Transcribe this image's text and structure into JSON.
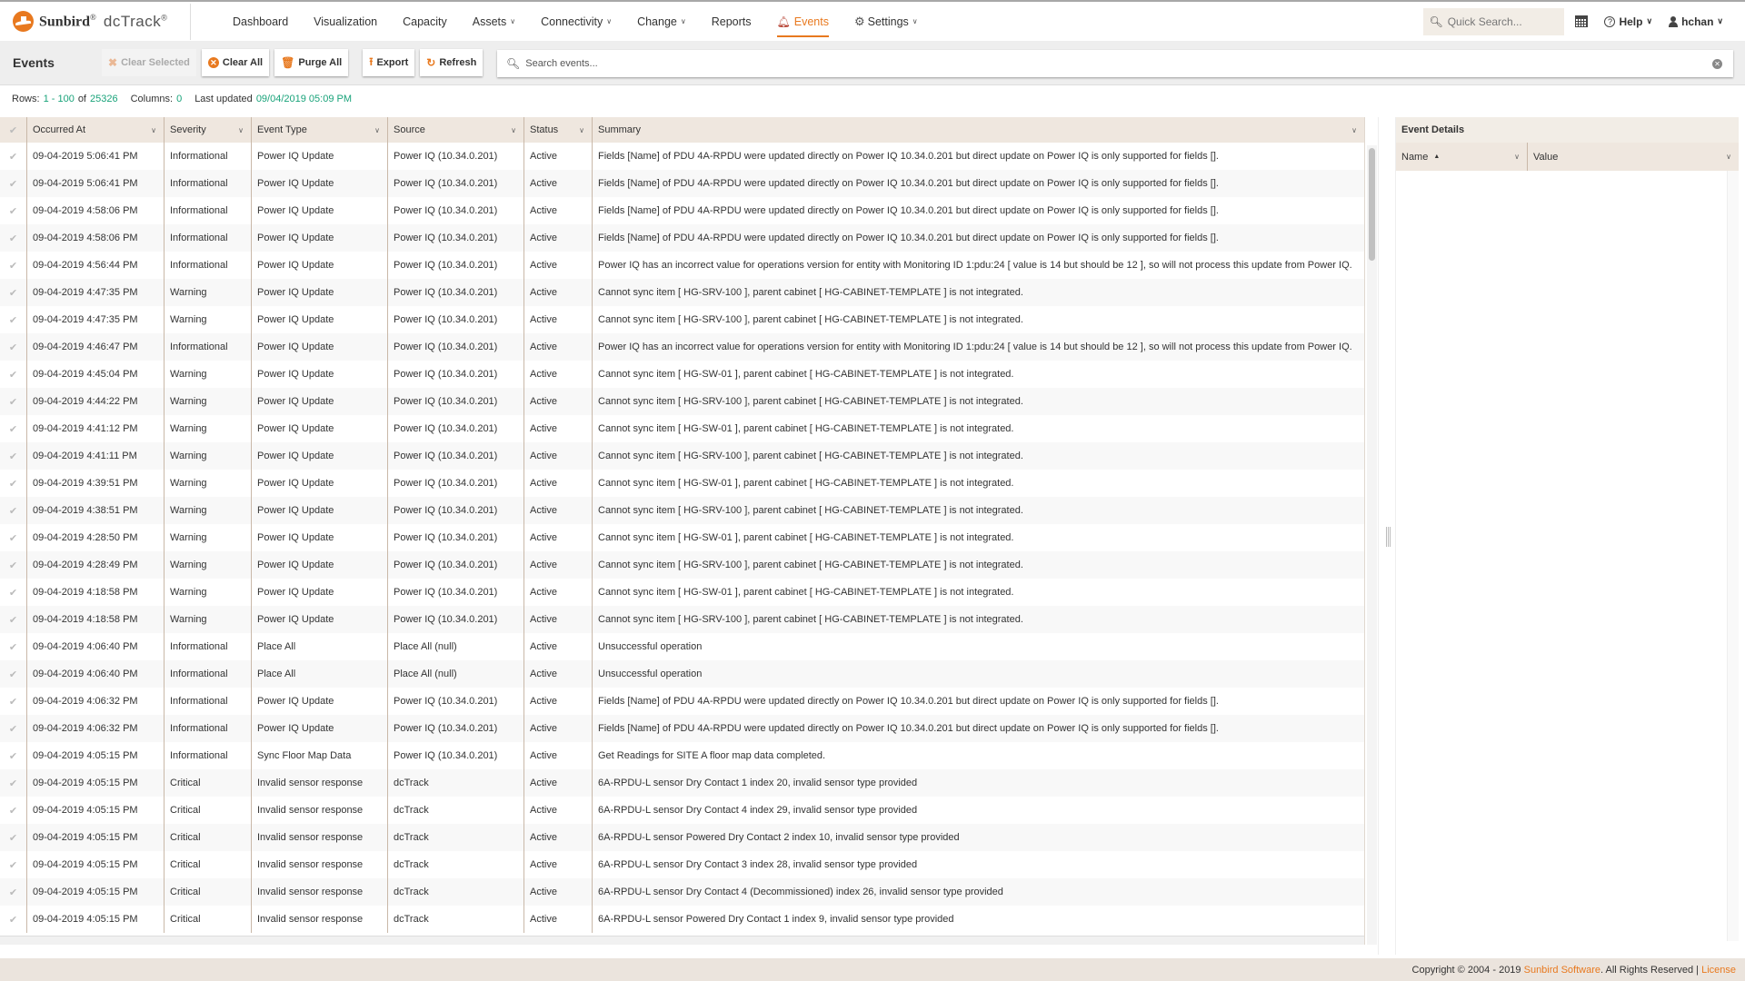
{
  "app": {
    "brand": "Sunbird",
    "product": "dcTrack",
    "reg": "®"
  },
  "nav": {
    "items": [
      {
        "label": "Dashboard",
        "dropdown": false
      },
      {
        "label": "Visualization",
        "dropdown": false
      },
      {
        "label": "Capacity",
        "dropdown": false
      },
      {
        "label": "Assets",
        "dropdown": true
      },
      {
        "label": "Connectivity",
        "dropdown": true
      },
      {
        "label": "Change",
        "dropdown": true
      },
      {
        "label": "Reports",
        "dropdown": false
      },
      {
        "label": "Events",
        "dropdown": false,
        "active": true,
        "icon": "bell-icon"
      },
      {
        "label": "Settings",
        "dropdown": true,
        "icon": "gear-icon"
      }
    ],
    "quick_search_placeholder": "Quick Search...",
    "help_label": "Help",
    "user_label": "hchan"
  },
  "toolbar": {
    "title": "Events",
    "clear_selected": "Clear Selected",
    "clear_all": "Clear All",
    "purge_all": "Purge All",
    "export": "Export",
    "refresh": "Refresh",
    "search_placeholder": "Search events..."
  },
  "info": {
    "rows_label": "Rows:",
    "rows_range": "1 - 100",
    "of_label": "of",
    "total": "25326",
    "columns_label": "Columns:",
    "columns_value": "0",
    "updated_label": "Last updated",
    "updated_value": "09/04/2019 05:09 PM"
  },
  "grid": {
    "columns": [
      "Occurred At",
      "Severity",
      "Event Type",
      "Source",
      "Status",
      "Summary"
    ],
    "rows": [
      {
        "occurred": "09-04-2019 5:06:41 PM",
        "severity": "Informational",
        "type": "Power IQ Update",
        "source": "Power IQ (10.34.0.201)",
        "status": "Active",
        "summary": "Fields [Name] of PDU 4A-RPDU were updated directly on Power IQ 10.34.0.201 but direct update on Power IQ is only supported for fields []."
      },
      {
        "occurred": "09-04-2019 5:06:41 PM",
        "severity": "Informational",
        "type": "Power IQ Update",
        "source": "Power IQ (10.34.0.201)",
        "status": "Active",
        "summary": "Fields [Name] of PDU 4A-RPDU were updated directly on Power IQ 10.34.0.201 but direct update on Power IQ is only supported for fields []."
      },
      {
        "occurred": "09-04-2019 4:58:06 PM",
        "severity": "Informational",
        "type": "Power IQ Update",
        "source": "Power IQ (10.34.0.201)",
        "status": "Active",
        "summary": "Fields [Name] of PDU 4A-RPDU were updated directly on Power IQ 10.34.0.201 but direct update on Power IQ is only supported for fields []."
      },
      {
        "occurred": "09-04-2019 4:58:06 PM",
        "severity": "Informational",
        "type": "Power IQ Update",
        "source": "Power IQ (10.34.0.201)",
        "status": "Active",
        "summary": "Fields [Name] of PDU 4A-RPDU were updated directly on Power IQ 10.34.0.201 but direct update on Power IQ is only supported for fields []."
      },
      {
        "occurred": "09-04-2019 4:56:44 PM",
        "severity": "Informational",
        "type": "Power IQ Update",
        "source": "Power IQ (10.34.0.201)",
        "status": "Active",
        "summary": "Power IQ has an incorrect value for operations version for entity with Monitoring ID 1:pdu:24 [ value is 14 but should be 12 ], so will not process this update from Power IQ."
      },
      {
        "occurred": "09-04-2019 4:47:35 PM",
        "severity": "Warning",
        "type": "Power IQ Update",
        "source": "Power IQ (10.34.0.201)",
        "status": "Active",
        "summary": "Cannot sync item [ HG-SRV-100 ], parent cabinet [ HG-CABINET-TEMPLATE ] is not integrated."
      },
      {
        "occurred": "09-04-2019 4:47:35 PM",
        "severity": "Warning",
        "type": "Power IQ Update",
        "source": "Power IQ (10.34.0.201)",
        "status": "Active",
        "summary": "Cannot sync item [ HG-SRV-100 ], parent cabinet [ HG-CABINET-TEMPLATE ] is not integrated."
      },
      {
        "occurred": "09-04-2019 4:46:47 PM",
        "severity": "Informational",
        "type": "Power IQ Update",
        "source": "Power IQ (10.34.0.201)",
        "status": "Active",
        "summary": "Power IQ has an incorrect value for operations version for entity with Monitoring ID 1:pdu:24 [ value is 14 but should be 12 ], so will not process this update from Power IQ."
      },
      {
        "occurred": "09-04-2019 4:45:04 PM",
        "severity": "Warning",
        "type": "Power IQ Update",
        "source": "Power IQ (10.34.0.201)",
        "status": "Active",
        "summary": "Cannot sync item [ HG-SW-01 ], parent cabinet [ HG-CABINET-TEMPLATE ] is not integrated."
      },
      {
        "occurred": "09-04-2019 4:44:22 PM",
        "severity": "Warning",
        "type": "Power IQ Update",
        "source": "Power IQ (10.34.0.201)",
        "status": "Active",
        "summary": "Cannot sync item [ HG-SRV-100 ], parent cabinet [ HG-CABINET-TEMPLATE ] is not integrated."
      },
      {
        "occurred": "09-04-2019 4:41:12 PM",
        "severity": "Warning",
        "type": "Power IQ Update",
        "source": "Power IQ (10.34.0.201)",
        "status": "Active",
        "summary": "Cannot sync item [ HG-SW-01 ], parent cabinet [ HG-CABINET-TEMPLATE ] is not integrated."
      },
      {
        "occurred": "09-04-2019 4:41:11 PM",
        "severity": "Warning",
        "type": "Power IQ Update",
        "source": "Power IQ (10.34.0.201)",
        "status": "Active",
        "summary": "Cannot sync item [ HG-SRV-100 ], parent cabinet [ HG-CABINET-TEMPLATE ] is not integrated."
      },
      {
        "occurred": "09-04-2019 4:39:51 PM",
        "severity": "Warning",
        "type": "Power IQ Update",
        "source": "Power IQ (10.34.0.201)",
        "status": "Active",
        "summary": "Cannot sync item [ HG-SW-01 ], parent cabinet [ HG-CABINET-TEMPLATE ] is not integrated."
      },
      {
        "occurred": "09-04-2019 4:38:51 PM",
        "severity": "Warning",
        "type": "Power IQ Update",
        "source": "Power IQ (10.34.0.201)",
        "status": "Active",
        "summary": "Cannot sync item [ HG-SRV-100 ], parent cabinet [ HG-CABINET-TEMPLATE ] is not integrated."
      },
      {
        "occurred": "09-04-2019 4:28:50 PM",
        "severity": "Warning",
        "type": "Power IQ Update",
        "source": "Power IQ (10.34.0.201)",
        "status": "Active",
        "summary": "Cannot sync item [ HG-SW-01 ], parent cabinet [ HG-CABINET-TEMPLATE ] is not integrated."
      },
      {
        "occurred": "09-04-2019 4:28:49 PM",
        "severity": "Warning",
        "type": "Power IQ Update",
        "source": "Power IQ (10.34.0.201)",
        "status": "Active",
        "summary": "Cannot sync item [ HG-SRV-100 ], parent cabinet [ HG-CABINET-TEMPLATE ] is not integrated."
      },
      {
        "occurred": "09-04-2019 4:18:58 PM",
        "severity": "Warning",
        "type": "Power IQ Update",
        "source": "Power IQ (10.34.0.201)",
        "status": "Active",
        "summary": "Cannot sync item [ HG-SW-01 ], parent cabinet [ HG-CABINET-TEMPLATE ] is not integrated."
      },
      {
        "occurred": "09-04-2019 4:18:58 PM",
        "severity": "Warning",
        "type": "Power IQ Update",
        "source": "Power IQ (10.34.0.201)",
        "status": "Active",
        "summary": "Cannot sync item [ HG-SRV-100 ], parent cabinet [ HG-CABINET-TEMPLATE ] is not integrated."
      },
      {
        "occurred": "09-04-2019 4:06:40 PM",
        "severity": "Informational",
        "type": "Place All",
        "source": "Place All (null)",
        "status": "Active",
        "summary": "Unsuccessful operation"
      },
      {
        "occurred": "09-04-2019 4:06:40 PM",
        "severity": "Informational",
        "type": "Place All",
        "source": "Place All (null)",
        "status": "Active",
        "summary": "Unsuccessful operation"
      },
      {
        "occurred": "09-04-2019 4:06:32 PM",
        "severity": "Informational",
        "type": "Power IQ Update",
        "source": "Power IQ (10.34.0.201)",
        "status": "Active",
        "summary": "Fields [Name] of PDU 4A-RPDU were updated directly on Power IQ 10.34.0.201 but direct update on Power IQ is only supported for fields []."
      },
      {
        "occurred": "09-04-2019 4:06:32 PM",
        "severity": "Informational",
        "type": "Power IQ Update",
        "source": "Power IQ (10.34.0.201)",
        "status": "Active",
        "summary": "Fields [Name] of PDU 4A-RPDU were updated directly on Power IQ 10.34.0.201 but direct update on Power IQ is only supported for fields []."
      },
      {
        "occurred": "09-04-2019 4:05:15 PM",
        "severity": "Informational",
        "type": "Sync Floor Map Data",
        "source": "Power IQ (10.34.0.201)",
        "status": "Active",
        "summary": "Get Readings for SITE A floor map data completed."
      },
      {
        "occurred": "09-04-2019 4:05:15 PM",
        "severity": "Critical",
        "type": "Invalid sensor response",
        "source": "dcTrack",
        "status": "Active",
        "summary": "6A-RPDU-L sensor Dry Contact 1 index 20, invalid sensor type provided"
      },
      {
        "occurred": "09-04-2019 4:05:15 PM",
        "severity": "Critical",
        "type": "Invalid sensor response",
        "source": "dcTrack",
        "status": "Active",
        "summary": "6A-RPDU-L sensor Dry Contact 4 index 29, invalid sensor type provided"
      },
      {
        "occurred": "09-04-2019 4:05:15 PM",
        "severity": "Critical",
        "type": "Invalid sensor response",
        "source": "dcTrack",
        "status": "Active",
        "summary": "6A-RPDU-L sensor Powered Dry Contact 2 index 10, invalid sensor type provided"
      },
      {
        "occurred": "09-04-2019 4:05:15 PM",
        "severity": "Critical",
        "type": "Invalid sensor response",
        "source": "dcTrack",
        "status": "Active",
        "summary": "6A-RPDU-L sensor Dry Contact 3 index 28, invalid sensor type provided"
      },
      {
        "occurred": "09-04-2019 4:05:15 PM",
        "severity": "Critical",
        "type": "Invalid sensor response",
        "source": "dcTrack",
        "status": "Active",
        "summary": "6A-RPDU-L sensor Dry Contact 4 (Decommissioned) index 26, invalid sensor type provided"
      },
      {
        "occurred": "09-04-2019 4:05:15 PM",
        "severity": "Critical",
        "type": "Invalid sensor response",
        "source": "dcTrack",
        "status": "Active",
        "summary": "6A-RPDU-L sensor Powered Dry Contact 1 index 9, invalid sensor type provided"
      }
    ]
  },
  "details": {
    "title": "Event Details",
    "col_name": "Name",
    "col_value": "Value"
  },
  "footer": {
    "prefix": "Copyright © 2004 - 2019 ",
    "company": "Sunbird Software",
    "suffix": ". All Rights Reserved | ",
    "license": "License"
  },
  "colors": {
    "accent": "#e8791f",
    "highlight_value": "#19a37a",
    "header_bg": "#efe7df"
  }
}
